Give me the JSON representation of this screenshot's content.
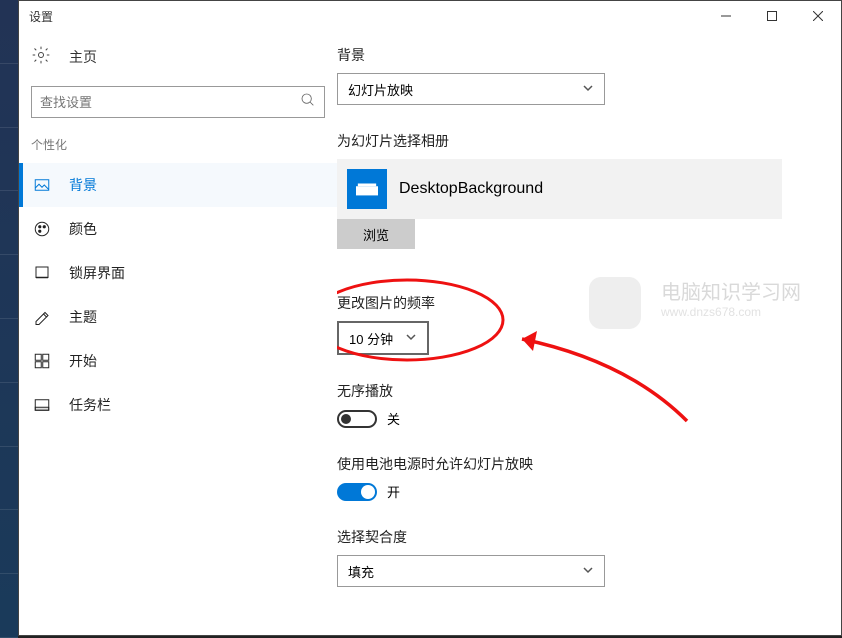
{
  "window": {
    "title": "设置"
  },
  "sidebar": {
    "home": "主页",
    "search_placeholder": "查找设置",
    "section": "个性化",
    "items": [
      {
        "label": "背景"
      },
      {
        "label": "颜色"
      },
      {
        "label": "锁屏界面"
      },
      {
        "label": "主题"
      },
      {
        "label": "开始"
      },
      {
        "label": "任务栏"
      }
    ]
  },
  "main": {
    "background_label": "背景",
    "background_value": "幻灯片放映",
    "album_label": "为幻灯片选择相册",
    "album_name": "DesktopBackground",
    "browse": "浏览",
    "frequency_label": "更改图片的频率",
    "frequency_value": "10 分钟",
    "shuffle_label": "无序播放",
    "shuffle_state": "关",
    "battery_label": "使用电池电源时允许幻灯片放映",
    "battery_state": "开",
    "fit_label": "选择契合度",
    "fit_value": "填充"
  },
  "watermark": {
    "line1": "电脑知识学习网",
    "line2": "www.dnzs678.com"
  }
}
